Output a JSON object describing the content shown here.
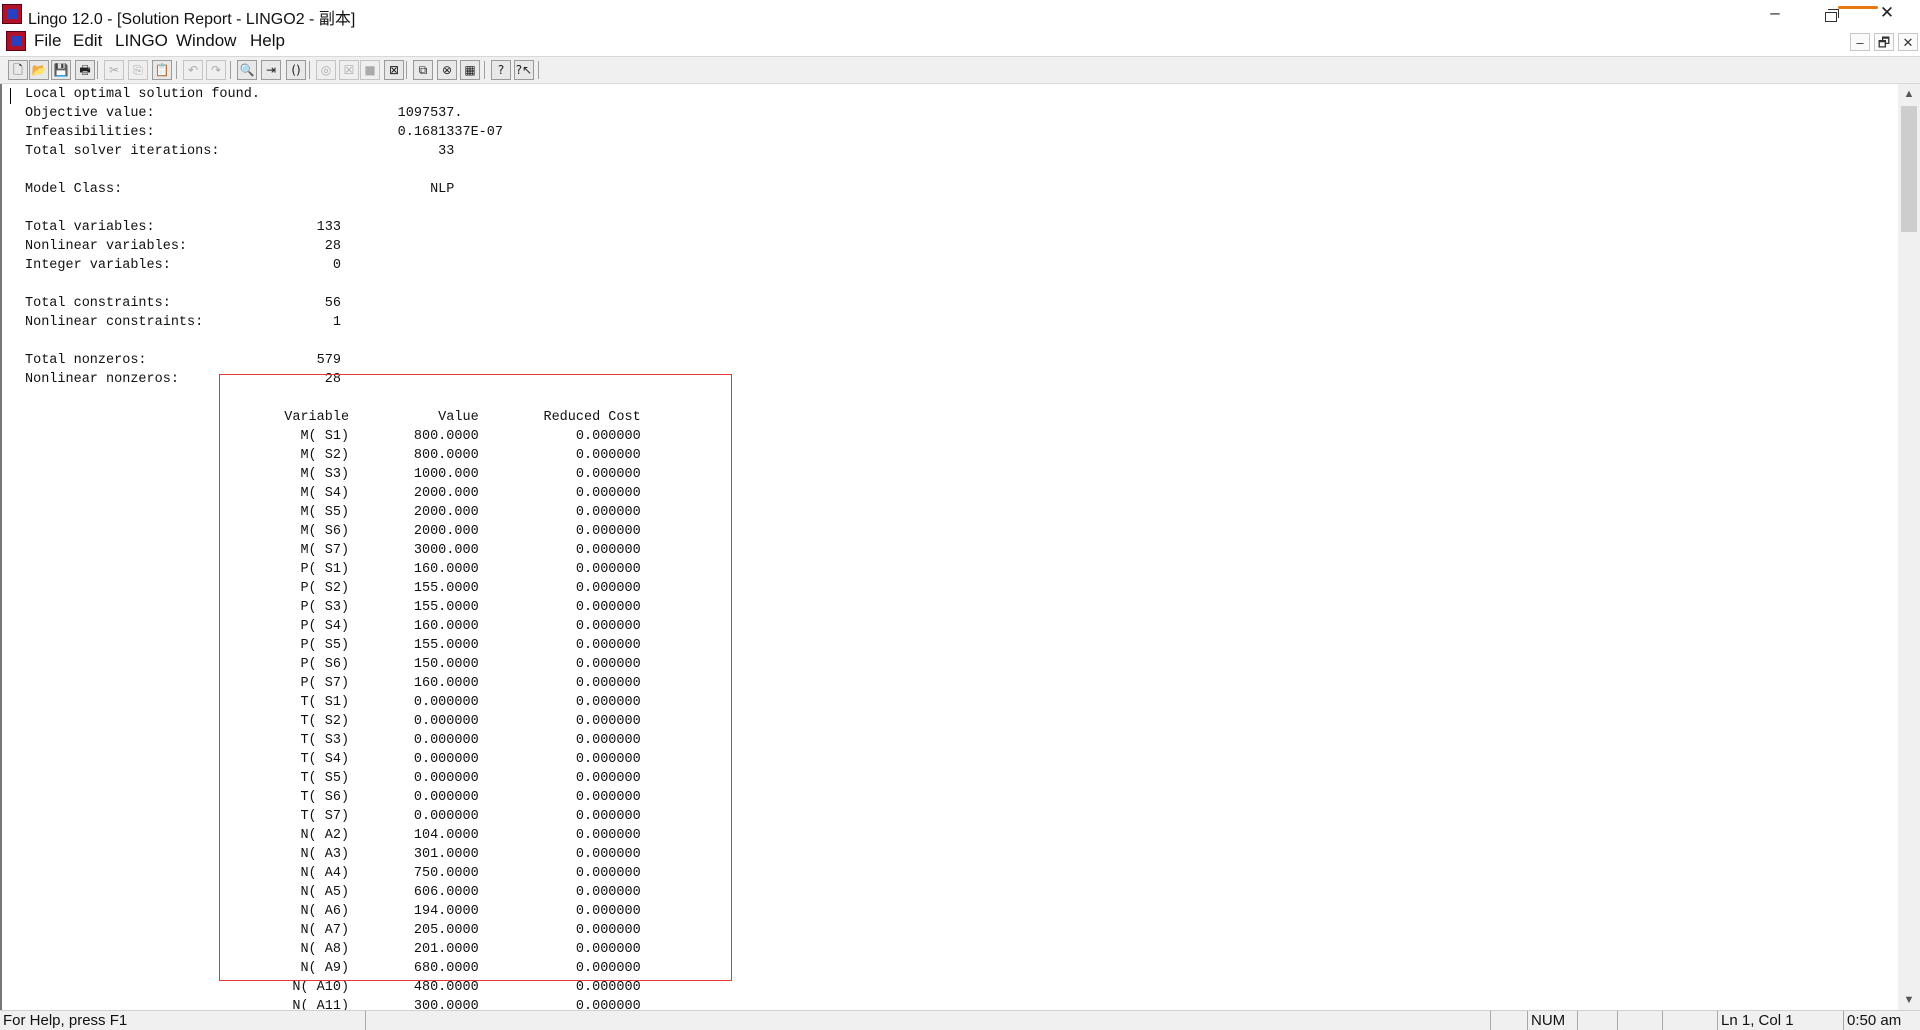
{
  "window": {
    "title": "Lingo 12.0 - [Solution Report - LINGO2 - 副本]",
    "min_glyph": "–",
    "close_glyph": "✕"
  },
  "menu": [
    "File",
    "Edit",
    "LINGO",
    "Window",
    "Help"
  ],
  "mdi_controls": [
    "–",
    "🗗",
    "✕"
  ],
  "toolbar": [
    {
      "icon": "new-file-icon",
      "glyph": "🗋",
      "enabled": true
    },
    {
      "icon": "open-file-icon",
      "glyph": "📂",
      "enabled": true
    },
    {
      "icon": "save-icon",
      "glyph": "💾",
      "enabled": true
    },
    {
      "icon": "print-icon",
      "glyph": "🖶",
      "enabled": true
    },
    {
      "icon": "cut-icon",
      "glyph": "✂",
      "enabled": false
    },
    {
      "icon": "copy-icon",
      "glyph": "⎘",
      "enabled": false
    },
    {
      "icon": "paste-icon",
      "glyph": "📋",
      "enabled": true
    },
    {
      "icon": "undo-icon",
      "glyph": "↶",
      "enabled": false
    },
    {
      "icon": "redo-icon",
      "glyph": "↷",
      "enabled": false
    },
    {
      "icon": "find-icon",
      "glyph": "🔍",
      "enabled": true
    },
    {
      "icon": "goto-line-icon",
      "glyph": "⇥",
      "enabled": true
    },
    {
      "icon": "match-parenthesis-icon",
      "glyph": "()",
      "enabled": true
    },
    {
      "icon": "solve-icon",
      "glyph": "◎",
      "enabled": false
    },
    {
      "icon": "solution-icon",
      "glyph": "☒",
      "enabled": false
    },
    {
      "icon": "stop-icon",
      "glyph": "■",
      "enabled": false
    },
    {
      "icon": "close-all-icon",
      "glyph": "⊠",
      "enabled": true
    },
    {
      "icon": "send-to-back-icon",
      "glyph": "⧉",
      "enabled": true
    },
    {
      "icon": "close-window-icon",
      "glyph": "⊗",
      "enabled": true
    },
    {
      "icon": "tile-icon",
      "glyph": "▦",
      "enabled": true
    },
    {
      "icon": "help-topics-icon",
      "glyph": "?",
      "enabled": true
    },
    {
      "icon": "context-help-icon",
      "glyph": "?↖",
      "enabled": true
    }
  ],
  "report": {
    "lines": [
      "Local optimal solution found.",
      "Objective value:                              1097537.",
      "Infeasibilities:                              0.1681337E-07",
      "Total solver iterations:                           33",
      "",
      "Model Class:                                      NLP",
      "",
      "Total variables:                    133",
      "Nonlinear variables:                 28",
      "Integer variables:                    0",
      "",
      "Total constraints:                   56",
      "Nonlinear constraints:                1",
      "",
      "Total nonzeros:                     579",
      "Nonlinear nonzeros:                  28",
      "",
      "                                Variable           Value        Reduced Cost",
      "                                  M( S1)        800.0000            0.000000",
      "                                  M( S2)        800.0000            0.000000",
      "                                  M( S3)        1000.000            0.000000",
      "                                  M( S4)        2000.000            0.000000",
      "                                  M( S5)        2000.000            0.000000",
      "                                  M( S6)        2000.000            0.000000",
      "                                  M( S7)        3000.000            0.000000",
      "                                  P( S1)        160.0000            0.000000",
      "                                  P( S2)        155.0000            0.000000",
      "                                  P( S3)        155.0000            0.000000",
      "                                  P( S4)        160.0000            0.000000",
      "                                  P( S5)        155.0000            0.000000",
      "                                  P( S6)        150.0000            0.000000",
      "                                  P( S7)        160.0000            0.000000",
      "                                  T( S1)        0.000000            0.000000",
      "                                  T( S2)        0.000000            0.000000",
      "                                  T( S3)        0.000000            0.000000",
      "                                  T( S4)        0.000000            0.000000",
      "                                  T( S5)        0.000000            0.000000",
      "                                  T( S6)        0.000000            0.000000",
      "                                  T( S7)        0.000000            0.000000",
      "                                  N( A2)        104.0000            0.000000",
      "                                  N( A3)        301.0000            0.000000",
      "                                  N( A4)        750.0000            0.000000",
      "                                  N( A5)        606.0000            0.000000",
      "                                  N( A6)        194.0000            0.000000",
      "                                  N( A7)        205.0000            0.000000",
      "                                  N( A8)        201.0000            0.000000",
      "                                  N( A9)        680.0000            0.000000",
      "                                 N( A10)        480.0000            0.000000",
      "                                 N( A11)        300.0000            0.000000"
    ]
  },
  "statusbar": {
    "help": "For Help, press F1",
    "num": "NUM",
    "position": "Ln 1, Col 1",
    "time": "0:50 am"
  },
  "colors": {
    "highlight_box": "#e53935",
    "titlebar_accent": "#e9760f"
  }
}
